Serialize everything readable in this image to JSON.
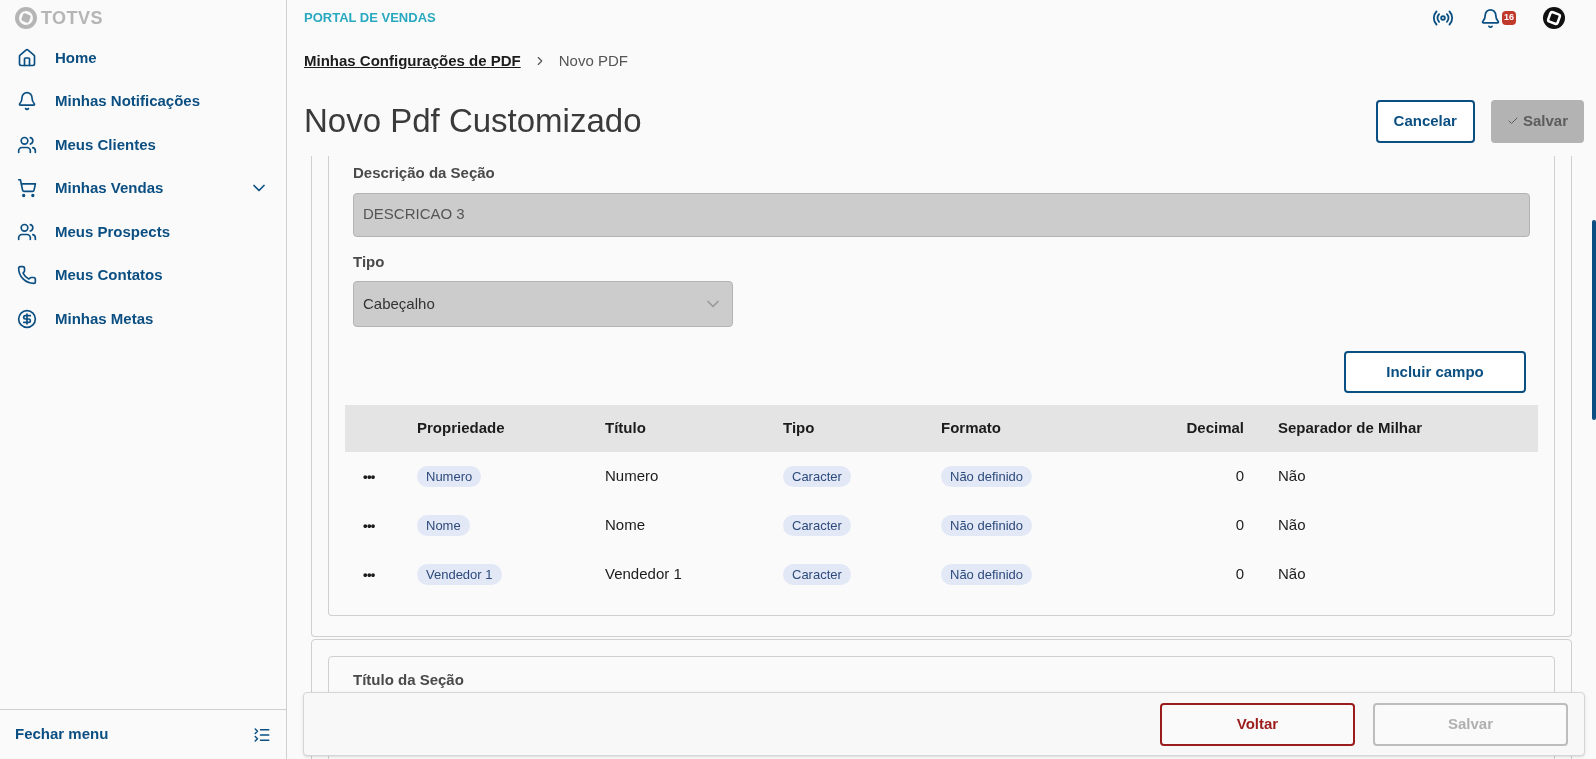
{
  "sidebar": {
    "logo": "TOTVS",
    "items": [
      {
        "label": "Home",
        "expandable": false
      },
      {
        "label": "Minhas Notificações",
        "expandable": false
      },
      {
        "label": "Meus Clientes",
        "expandable": false
      },
      {
        "label": "Minhas Vendas",
        "expandable": true
      },
      {
        "label": "Meus Prospects",
        "expandable": false
      },
      {
        "label": "Meus Contatos",
        "expandable": false
      },
      {
        "label": "Minhas Metas",
        "expandable": false
      }
    ],
    "footer": "Fechar menu"
  },
  "header": {
    "title": "PORTAL DE VENDAS",
    "notification_count": "16"
  },
  "breadcrumb": [
    {
      "label": "Minhas Configurações de PDF",
      "link": true
    },
    {
      "label": "Novo PDF",
      "link": false
    }
  ],
  "page": {
    "title": "Novo Pdf Customizado",
    "actions": [
      {
        "label": "Cancelar",
        "kind": "outline",
        "disabled": false
      },
      {
        "label": "Salvar",
        "kind": "check",
        "disabled": true
      }
    ]
  },
  "section": {
    "description_label": "Descrição da Seção",
    "description_value": "DESCRICAO 3",
    "type_label": "Tipo",
    "type_value": "Cabeçalho",
    "add_button": "Incluir campo",
    "table": {
      "columns": [
        "Propriedade",
        "Título",
        "Tipo",
        "Formato",
        "Decimal",
        "Separador de Milhar"
      ],
      "rows": [
        {
          "actions": "•••",
          "property": "Numero",
          "title": "Numero",
          "type": "Caracter",
          "format": "Não definido",
          "decimal": "0",
          "separator": "Não"
        },
        {
          "actions": "•••",
          "property": "Nome",
          "title": "Nome",
          "type": "Caracter",
          "format": "Não definido",
          "decimal": "0",
          "separator": "Não"
        },
        {
          "actions": "•••",
          "property": "Vendedor 1",
          "title": "Vendedor 1",
          "type": "Caracter",
          "format": "Não definido",
          "decimal": "0",
          "separator": "Não"
        }
      ]
    }
  },
  "next_section": {
    "title_label": "Título da Seção"
  },
  "footer": {
    "buttons": [
      {
        "label": "Voltar",
        "disabled": false
      },
      {
        "label": "Salvar",
        "disabled": true
      }
    ]
  }
}
